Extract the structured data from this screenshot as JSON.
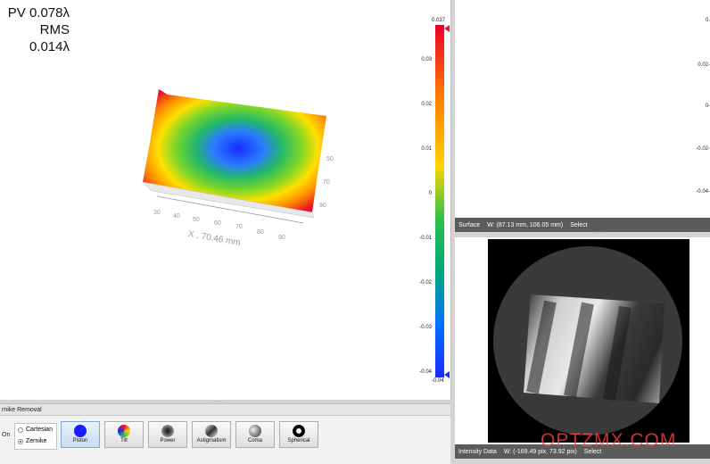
{
  "stats": {
    "pv": "PV 0.078λ",
    "rms": "RMS 0.014λ"
  },
  "colorbar": {
    "top_value": "0.037",
    "bottom_value": "-0.04",
    "ticks": [
      "0.03",
      "0.02",
      "0.01",
      "0",
      "-0.01",
      "-0.02",
      "-0.03",
      "-0.04"
    ]
  },
  "surface_plot": {
    "x_axis_label": "X , 70.46 mm",
    "x_ticks": [
      "30",
      "40",
      "50",
      "60",
      "70",
      "80",
      "90"
    ],
    "y_ticks": [
      "50",
      "70",
      "90"
    ]
  },
  "right_top": {
    "tick_labels": [
      "0.",
      "0.02-",
      "0-",
      "-0.02-",
      "-0.04-"
    ]
  },
  "surface_status": {
    "mode": "Surface",
    "coords": "W: (87.13 mm, 106.05 mm)",
    "tool": "Select"
  },
  "intensity_status": {
    "mode": "Intensity Data",
    "coords": "W: (-169.49 pix, 73.92 pix)",
    "tool": "Select"
  },
  "zernike_panel": {
    "title": "rnike Removal",
    "on_label": "On",
    "radio_options": [
      {
        "label": "Cartesian",
        "selected": false
      },
      {
        "label": "Zernike",
        "selected": true
      }
    ],
    "buttons": [
      {
        "label": "Piston",
        "active": true,
        "color": "#1a1aff"
      },
      {
        "label": "Tilt",
        "active": false,
        "color": "#ff6a00"
      },
      {
        "label": "Power",
        "active": false,
        "color": "#222222"
      },
      {
        "label": "Astigmatism",
        "active": false,
        "color": "#444444"
      },
      {
        "label": "Coma",
        "active": false,
        "color": "#777777"
      },
      {
        "label": "Spherical",
        "active": false,
        "color": "#000000"
      }
    ]
  },
  "watermark": "OPTZMX.COM"
}
